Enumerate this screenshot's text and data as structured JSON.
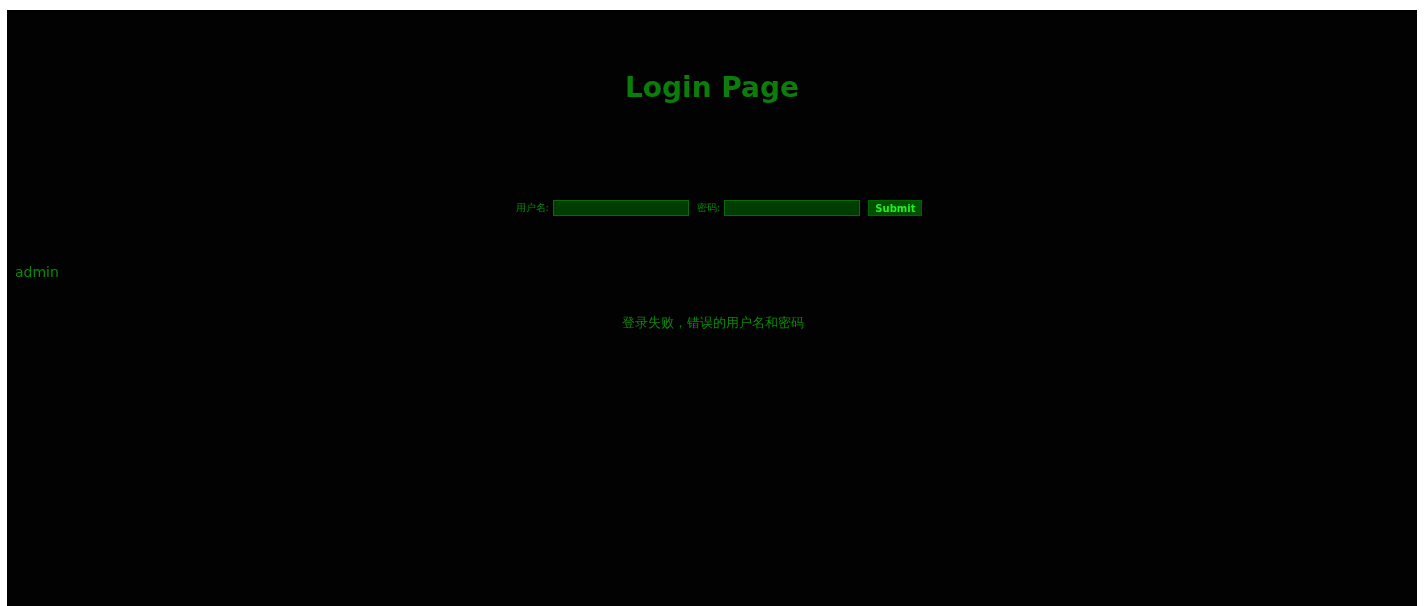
{
  "title": "Login Page",
  "form": {
    "username_label": "用户名:",
    "password_label": "密码:",
    "submit": "Submit"
  },
  "echo": "admin",
  "message": "登录失败，错误的用户名和密码"
}
